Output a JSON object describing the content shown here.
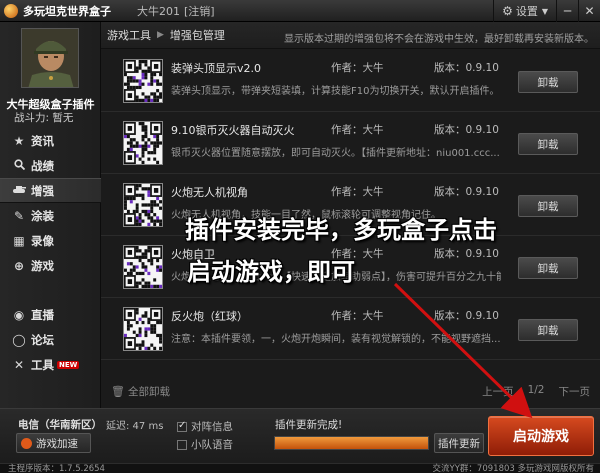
{
  "titlebar": {
    "app_title": "多玩坦克世界盒子",
    "user_name": "大牛201",
    "logout": "[注销]",
    "settings": "设置",
    "minimize": "─",
    "close": "✕"
  },
  "profile": {
    "name": "大牛超级盒子插件",
    "power": "战斗力: 暂无"
  },
  "nav": [
    {
      "label": "资讯",
      "icon": "star-icon",
      "glyph": "★"
    },
    {
      "label": "战绩",
      "icon": "search-icon",
      "glyph": "🔍"
    },
    {
      "label": "增强",
      "icon": "tank-icon",
      "glyph": "▰"
    },
    {
      "label": "涂装",
      "icon": "brush-icon",
      "glyph": "✎"
    },
    {
      "label": "录像",
      "icon": "film-icon",
      "glyph": "▦"
    },
    {
      "label": "游戏",
      "icon": "gamepad-icon",
      "glyph": "⊕"
    },
    {
      "label": "直播",
      "icon": "broadcast-icon",
      "glyph": "◉"
    },
    {
      "label": "论坛",
      "icon": "chat-icon",
      "glyph": "◯"
    },
    {
      "label": "工具",
      "icon": "tools-icon",
      "glyph": "✕",
      "badge": "NEW"
    }
  ],
  "breadcrumb": {
    "item1": "游戏工具",
    "item2": "增强包管理",
    "notice": "显示版本过期的增强包将不会在游戏中生效，最好卸载再安装新版本。"
  },
  "plugins": [
    {
      "name": "装弹头顶显示v2.0",
      "author": "作者：大牛",
      "version": "版本：0.9.10",
      "desc": "装弹头顶显示，带弹夹短装填，计算技能F10为切换开关，默认开启插件。",
      "button": "卸载"
    },
    {
      "name": "9.10银币灭火器自动灭火",
      "author": "作者：大牛",
      "version": "版本：0.9.10",
      "desc": "银币灭火器位置随意摆放，即可自动灭火。【插件更新地址：niu001.ccc...",
      "button": "卸载"
    },
    {
      "name": "火炮无人机视角",
      "author": "作者：大牛",
      "version": "版本：0.9.10",
      "desc": "火炮无人机视角，技能一目了然，鼠标滚轮可调整视角记住。",
      "button": "卸载"
    },
    {
      "name": "火炮自卫",
      "author": "作者：大牛",
      "version": "版本：0.9.10",
      "desc": "火炮自卫必备，配合大牛【快速锁定加辅助弱点】，伤害可提升百分之九十能...",
      "button": "卸载"
    },
    {
      "name": "反火炮（红球）",
      "author": "作者：大牛",
      "version": "版本：0.9.10",
      "desc": "注意：本插件要领，一，火炮开炮瞬间，装有视觉解锁的，不能视野遮挡...",
      "button": "卸载"
    }
  ],
  "footer": {
    "uninstall_all": "全部卸载",
    "prev": "上一页",
    "page": "1/2",
    "next": "下一页"
  },
  "overlay": {
    "line1": "插件安装完毕，多玩盒子点击",
    "line2": "启动游戏，即可"
  },
  "bottom": {
    "server": "电信（华南新区）",
    "latency": "延迟: 47 ms",
    "accel": "游戏加速",
    "check1": "对阵信息",
    "check2": "小队语音",
    "update_label": "插件更新完成!",
    "update_btn": "插件更新",
    "launch": "启动游戏",
    "progress": 1.0
  },
  "status": {
    "left": "主程序版本：1.7.5.2654",
    "right": "交流YY群：7091803  多玩游戏网版权所有"
  },
  "colors": {
    "launch": "#c33a14",
    "progress": "#e2782a",
    "arrow": "#d01010"
  }
}
